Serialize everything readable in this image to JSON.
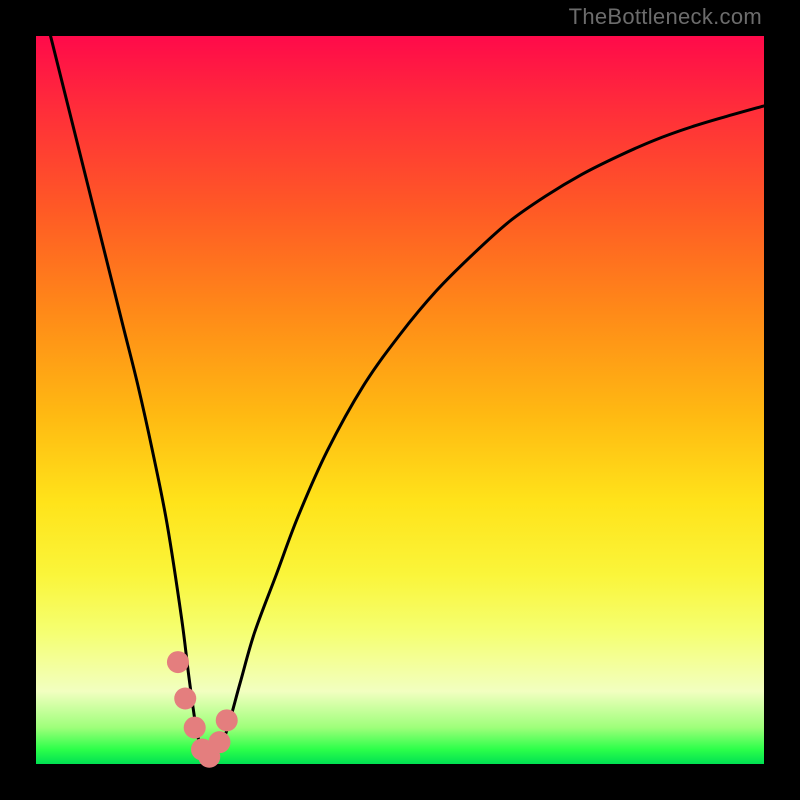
{
  "watermark": "TheBottleneck.com",
  "colors": {
    "curve_stroke": "#000000",
    "marker_fill": "#e47e7e",
    "marker_stroke": "#9a3a3a",
    "frame": "#000000"
  },
  "chart_data": {
    "type": "line",
    "title": "",
    "xlabel": "",
    "ylabel": "",
    "xlim": [
      0,
      100
    ],
    "ylim": [
      0,
      100
    ],
    "series": [
      {
        "name": "bottleneck-curve",
        "x": [
          0,
          2,
          4,
          6,
          8,
          10,
          12,
          14,
          16,
          18,
          20,
          21,
          22,
          23,
          24,
          26,
          28,
          30,
          33,
          36,
          40,
          45,
          50,
          55,
          60,
          65,
          70,
          75,
          80,
          85,
          90,
          95,
          100
        ],
        "values": [
          108,
          100,
          92,
          84,
          76,
          68,
          60,
          52,
          43,
          33,
          20,
          12,
          5,
          1,
          0,
          4,
          11,
          18,
          26,
          34,
          43,
          52,
          59,
          65,
          70,
          74.5,
          78,
          81,
          83.5,
          85.7,
          87.5,
          89,
          90.4
        ]
      }
    ],
    "markers": {
      "name": "highlight-points",
      "x": [
        19.5,
        20.5,
        21.8,
        22.8,
        23.8,
        25.2,
        26.2
      ],
      "values": [
        14,
        9,
        5,
        2,
        1,
        3,
        6
      ]
    }
  }
}
